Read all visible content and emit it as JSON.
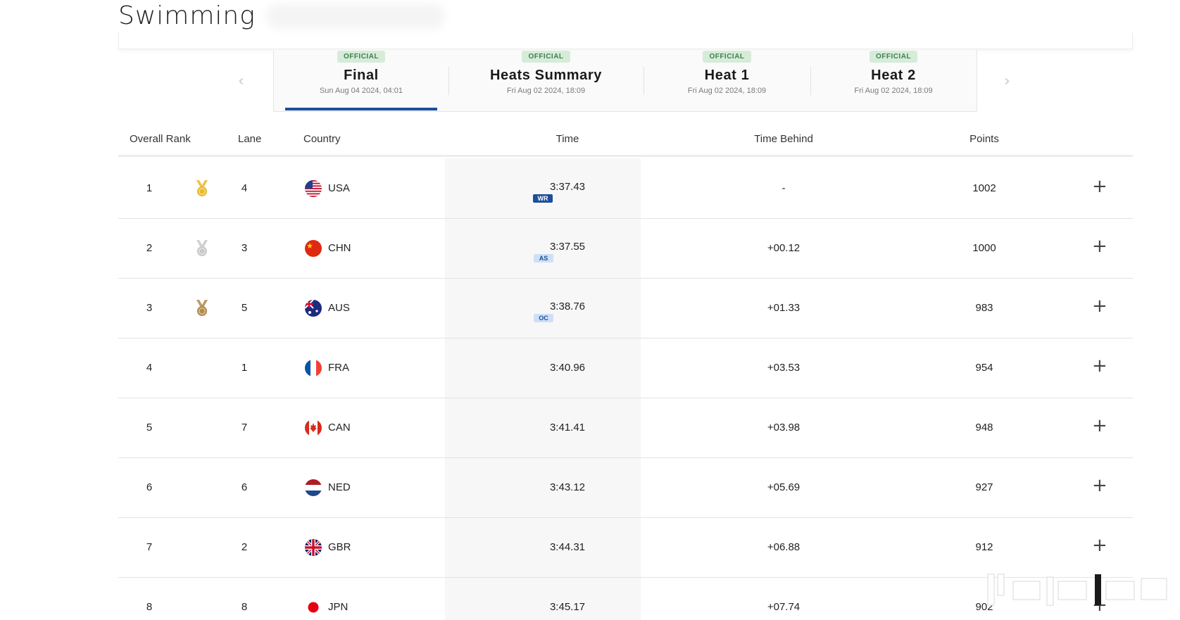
{
  "page": {
    "title": "Swimming"
  },
  "tabs": [
    {
      "badge": "OFFICIAL",
      "label": "Final",
      "date": "Sun Aug 04 2024, 04:01",
      "active": true
    },
    {
      "badge": "OFFICIAL",
      "label": "Heats Summary",
      "date": "Fri Aug 02 2024, 18:09",
      "active": false
    },
    {
      "badge": "OFFICIAL",
      "label": "Heat 1",
      "date": "Fri Aug 02 2024, 18:09",
      "active": false
    },
    {
      "badge": "OFFICIAL",
      "label": "Heat 2",
      "date": "Fri Aug 02 2024, 18:09",
      "active": false
    }
  ],
  "nav": {
    "prev_icon": "chevron-left-icon",
    "next_icon": "chevron-right-icon"
  },
  "table": {
    "headers": {
      "rank": "Overall Rank",
      "lane": "Lane",
      "country": "Country",
      "time": "Time",
      "behind": "Time Behind",
      "points": "Points"
    },
    "rows": [
      {
        "rank": "1",
        "medal": "gold",
        "lane": "4",
        "flag": "usa-flag-icon",
        "country": "USA",
        "time": "3:37.43",
        "record": "WR",
        "behind": "-",
        "points": "1002"
      },
      {
        "rank": "2",
        "medal": "silver",
        "lane": "3",
        "flag": "chn-flag-icon",
        "country": "CHN",
        "time": "3:37.55",
        "record": "AS",
        "behind": "+00.12",
        "points": "1000"
      },
      {
        "rank": "3",
        "medal": "bronze",
        "lane": "5",
        "flag": "aus-flag-icon",
        "country": "AUS",
        "time": "3:38.76",
        "record": "OC",
        "behind": "+01.33",
        "points": "983"
      },
      {
        "rank": "4",
        "medal": "",
        "lane": "1",
        "flag": "fra-flag-icon",
        "country": "FRA",
        "time": "3:40.96",
        "record": "",
        "behind": "+03.53",
        "points": "954"
      },
      {
        "rank": "5",
        "medal": "",
        "lane": "7",
        "flag": "can-flag-icon",
        "country": "CAN",
        "time": "3:41.41",
        "record": "",
        "behind": "+03.98",
        "points": "948"
      },
      {
        "rank": "6",
        "medal": "",
        "lane": "6",
        "flag": "ned-flag-icon",
        "country": "NED",
        "time": "3:43.12",
        "record": "",
        "behind": "+05.69",
        "points": "927"
      },
      {
        "rank": "7",
        "medal": "",
        "lane": "2",
        "flag": "gbr-flag-icon",
        "country": "GBR",
        "time": "3:44.31",
        "record": "",
        "behind": "+06.88",
        "points": "912"
      },
      {
        "rank": "8",
        "medal": "",
        "lane": "8",
        "flag": "jpn-flag-icon",
        "country": "JPN",
        "time": "3:45.17",
        "record": "",
        "behind": "+07.74",
        "points": "902"
      }
    ],
    "expand_icon": "plus-icon"
  },
  "colors": {
    "accent": "#1d4f9a",
    "official_bg": "#d6ecd9",
    "official_text": "#3f7f4c",
    "gold": "#e8b92a",
    "silver": "#c9c9c9",
    "bronze": "#b08a4a"
  }
}
